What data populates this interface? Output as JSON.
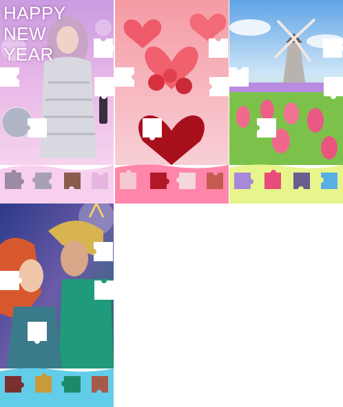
{
  "cards": [
    {
      "id": "new-year",
      "headline": "HAPPY NEW\nYEAR",
      "colors": {
        "top": "#d9b0e8",
        "mid": "#f3c7e6",
        "tray": "#f8d0ef"
      }
    },
    {
      "id": "hearts",
      "headline": "",
      "colors": {
        "top": "#f7a0a8",
        "mid": "#f6c2cc",
        "tray": "#ff7fa6"
      }
    },
    {
      "id": "tulips",
      "headline": "",
      "colors": {
        "top": "#7fb7ec",
        "mid": "#f6a6c8",
        "tray": "#e6f58a"
      }
    },
    {
      "id": "sea-royals",
      "headline": "",
      "colors": {
        "top": "#2e3f86",
        "mid": "#3b8f8a",
        "tray": "#5ec8e8"
      }
    }
  ]
}
